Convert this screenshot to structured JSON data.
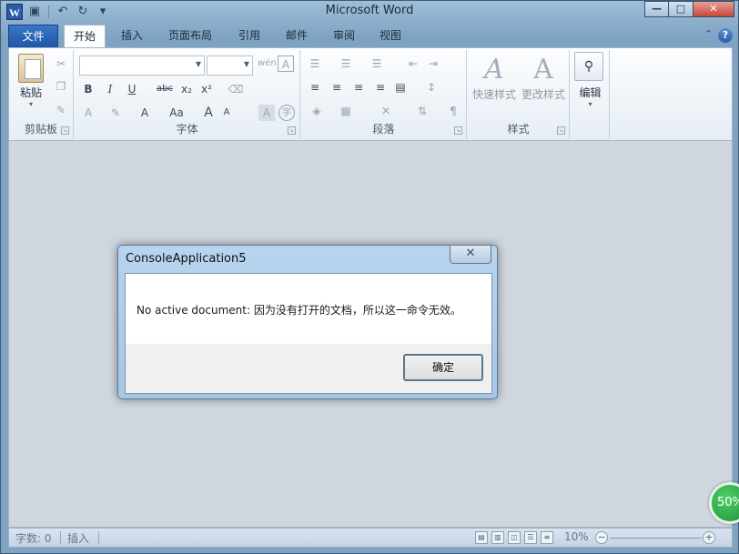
{
  "window": {
    "title": "Microsoft Word",
    "minimize": "—",
    "maximize": "□",
    "close": "✕"
  },
  "quick_access": {
    "app_icon": "W",
    "items": [
      {
        "icon": "save-icon",
        "glyph": "▣"
      },
      {
        "icon": "undo-icon",
        "glyph": "↶"
      },
      {
        "icon": "redo-icon",
        "glyph": "↻"
      },
      {
        "icon": "customize-icon",
        "glyph": "▾"
      }
    ]
  },
  "tabs": [
    {
      "label": "文件"
    },
    {
      "label": "开始"
    },
    {
      "label": "插入"
    },
    {
      "label": "页面布局"
    },
    {
      "label": "引用"
    },
    {
      "label": "邮件"
    },
    {
      "label": "审阅"
    },
    {
      "label": "视图"
    }
  ],
  "ribbon": {
    "clipboard": {
      "label": "剪贴板",
      "paste": "粘贴"
    },
    "font": {
      "label": "字体",
      "bold": "B",
      "italic": "I",
      "underline": "U",
      "strike": "abc",
      "subscript": "x₂",
      "superscript": "x²",
      "grow": "A",
      "shrink": "A",
      "case": "Aa",
      "phonetic": "wén",
      "char_border": "A",
      "enclose": "字"
    },
    "paragraph": {
      "label": "段落"
    },
    "styles": {
      "label": "样式",
      "quick": "快速样式",
      "change": "更改样式"
    },
    "editing": {
      "label": "编辑"
    }
  },
  "statusbar": {
    "word_count": "字数: 0",
    "insert_mode": "插入",
    "zoom": "10%",
    "zoom_minus": "−",
    "zoom_plus": "+"
  },
  "badge": {
    "text": "50%"
  },
  "dialog": {
    "title": "ConsoleApplication5",
    "close": "✕",
    "message": "No active document: 因为没有打开的文档，所以这一命令无效。",
    "ok": "确定"
  },
  "colors": {
    "file_tab": "#2a63b3",
    "badge": "#2aa845",
    "dialog_frame": "#a6c6e4"
  }
}
